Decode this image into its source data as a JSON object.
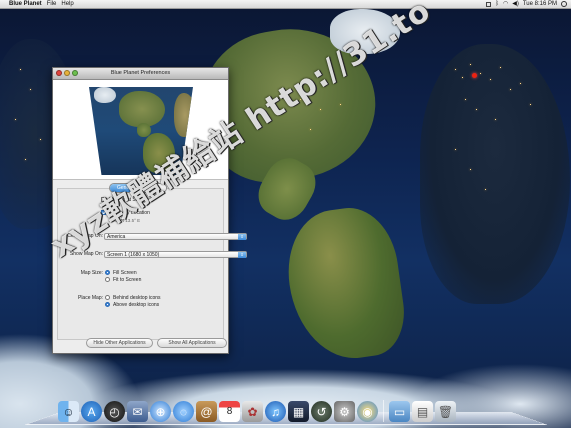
{
  "menubar": {
    "apple_glyph": "",
    "app_name": "Blue Planet",
    "menus": [
      "File",
      "Help"
    ],
    "clock": "Tue 8:16 PM"
  },
  "window": {
    "title": "Blue Planet Preferences",
    "tabs": [
      {
        "label": "General",
        "active": true
      },
      {
        "label": "Map",
        "active": false
      }
    ],
    "launch_at_startup": {
      "label": "Launch at Startup",
      "checked": false
    },
    "show_my_location": {
      "label": "Show my Location",
      "checked": true
    },
    "location_coords": "12.5° N 13.5° E",
    "center_map_on": {
      "label": "Center Map On:",
      "value": "America"
    },
    "show_map_on": {
      "label": "Show Map On:",
      "value": "Screen 1 (1680 x 1050)"
    },
    "map_size": {
      "label": "Map Size:",
      "options": [
        {
          "label": "Fill Screen",
          "selected": true
        },
        {
          "label": "Fit to Screen",
          "selected": false
        }
      ]
    },
    "place_map": {
      "label": "Place Map:",
      "options": [
        {
          "label": "Behind desktop icons",
          "selected": false
        },
        {
          "label": "Above desktop icons",
          "selected": true
        }
      ]
    },
    "buttons": {
      "hide_other": "Hide Other Applications",
      "show_all": "Show All Applications"
    }
  },
  "watermark": "xyz軟體補給站 http://31.to",
  "dock": {
    "icons": [
      "finder-icon",
      "app-store-icon",
      "dashboard-icon",
      "mail-icon",
      "safari-icon",
      "ichat-icon",
      "address-book-icon",
      "ical-icon",
      "iphoto-icon",
      "itunes-icon",
      "spaces-icon",
      "time-machine-icon",
      "system-preferences-icon",
      "globe-icon",
      "applications-folder-icon",
      "documents-stack-icon",
      "trash-icon"
    ]
  },
  "colors": {
    "accent": "#3d8ad8",
    "marker": "#ee2211",
    "ocean": "#123063"
  }
}
